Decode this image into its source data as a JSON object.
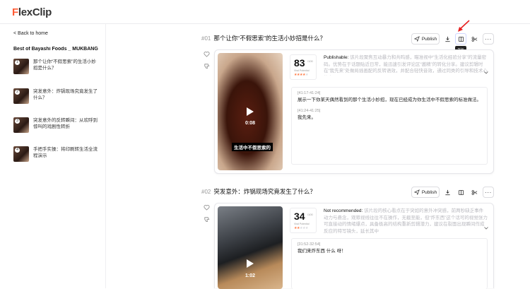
{
  "app": {
    "logo_prefix": "F",
    "logo_rest": "lexClip",
    "brand_color": "#ff5c35"
  },
  "sidebar": {
    "back_label": "< Back to home",
    "video_title": "Best of Bayashi Foods _ MUKBANG _...",
    "items": [
      {
        "num": "1",
        "label": "那个让你“不假思索”的生活小妙招是什么？"
      },
      {
        "num": "2",
        "label": "突发意外：炸锅现场究竟发生了什么？"
      },
      {
        "num": "3",
        "label": "突发意外的反转瞬间：从欢呼到惊叫的戏剧性转折"
      },
      {
        "num": "4",
        "label": "手把手实操：将印刷转生活全流程演示"
      }
    ]
  },
  "toolbar": {
    "publish_label": "Publish",
    "trim_tooltip": "Trim"
  },
  "clips": [
    {
      "index": "#01",
      "title": "那个让你“不假思索”的生活小妙招是什么？",
      "score": "83",
      "score_max": "/100",
      "viral_label": "Viral Potential",
      "stars_on": 4,
      "verdict": "Publishable:",
      "description": "该片段聚焦互动暴力和共鸣感，瞄准视中“生活化经验分享”的流量密码。优势在于话题贴近日常，能迅速引发评论区“邀精”的转化分享。建议剪辑时在“我先来”处做局插画配的反转语效，并配合轻快音效，通过同类的引导和技术心的实现",
      "duration": "0:08",
      "caption": "生活中不假思索的",
      "lines": [
        {
          "ts": "[41:17-41:24]",
          "text": "展示一下你某天偶然看到的那个生活小妙招，现在已经成为你生活中不假思索的标准做法。"
        },
        {
          "ts": "[41:24-41:25]",
          "text": "我先来。"
        }
      ]
    },
    {
      "index": "#02",
      "title": "突发意外：炸锅现场究竟发生了什么？",
      "score": "34",
      "score_max": "/100",
      "viral_label": "Viral Potential",
      "stars_on": 2,
      "verdict": "Not recommended:",
      "description": "该片段的核心看点在于突如的意外冲突感，前两秒缺乏事件动力与悬念，观眾视线往往不在操作，无截至能，但“炸东西”这个话可的视觉张力可直接动的情绪爆点，具备极高的结构重新剪辑潜力，建议在裂面出现瞬间作成反应的特写镜头，延长其中",
      "duration": "1:02",
      "caption": "",
      "lines": [
        {
          "ts": "[31:52-32:54]",
          "text": "我们来炸东西 什么 呀！"
        }
      ]
    }
  ]
}
